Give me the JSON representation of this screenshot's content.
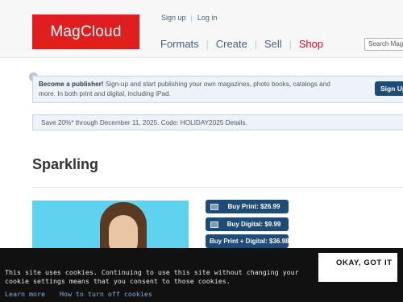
{
  "header": {
    "logo_text": "MagCloud",
    "sign_up": "Sign up",
    "auth_sep": "|",
    "log_in": "Log in",
    "nav": [
      "Formats",
      "Create",
      "Sell",
      "Shop"
    ],
    "nav_sep": "|",
    "search_placeholder": "Search MagCloud"
  },
  "publisher_banner": {
    "close_glyph": "×",
    "bold": "Become a publisher!",
    "text": " Sign-up and start publishing your own magazines, photo books, catalogs and more. In both print and digital, including iPad.",
    "button": "Sign Up"
  },
  "promo": {
    "text": "Save 20%* through December 11, 2025. Code: HOLIDAY2025 Details."
  },
  "product": {
    "title": "Sparkling",
    "buy_print": "Buy Print: $26.99",
    "buy_digital": "Buy Digital: $9.99",
    "buy_both": "Buy Print + Digital: $36.98"
  },
  "cookie": {
    "text": "This site uses cookies. Continuing to use this site without changing your cookie settings means that you consent to those cookies.",
    "learn_more": "Learn more",
    "how_to": "How to turn off cookies",
    "ok": "OKAY, GOT IT"
  },
  "colors": {
    "brand_red": "#e01e1e",
    "button_blue": "#1f4c77",
    "banner_bg": "#eef3f9",
    "shop_red": "#c4122f"
  }
}
